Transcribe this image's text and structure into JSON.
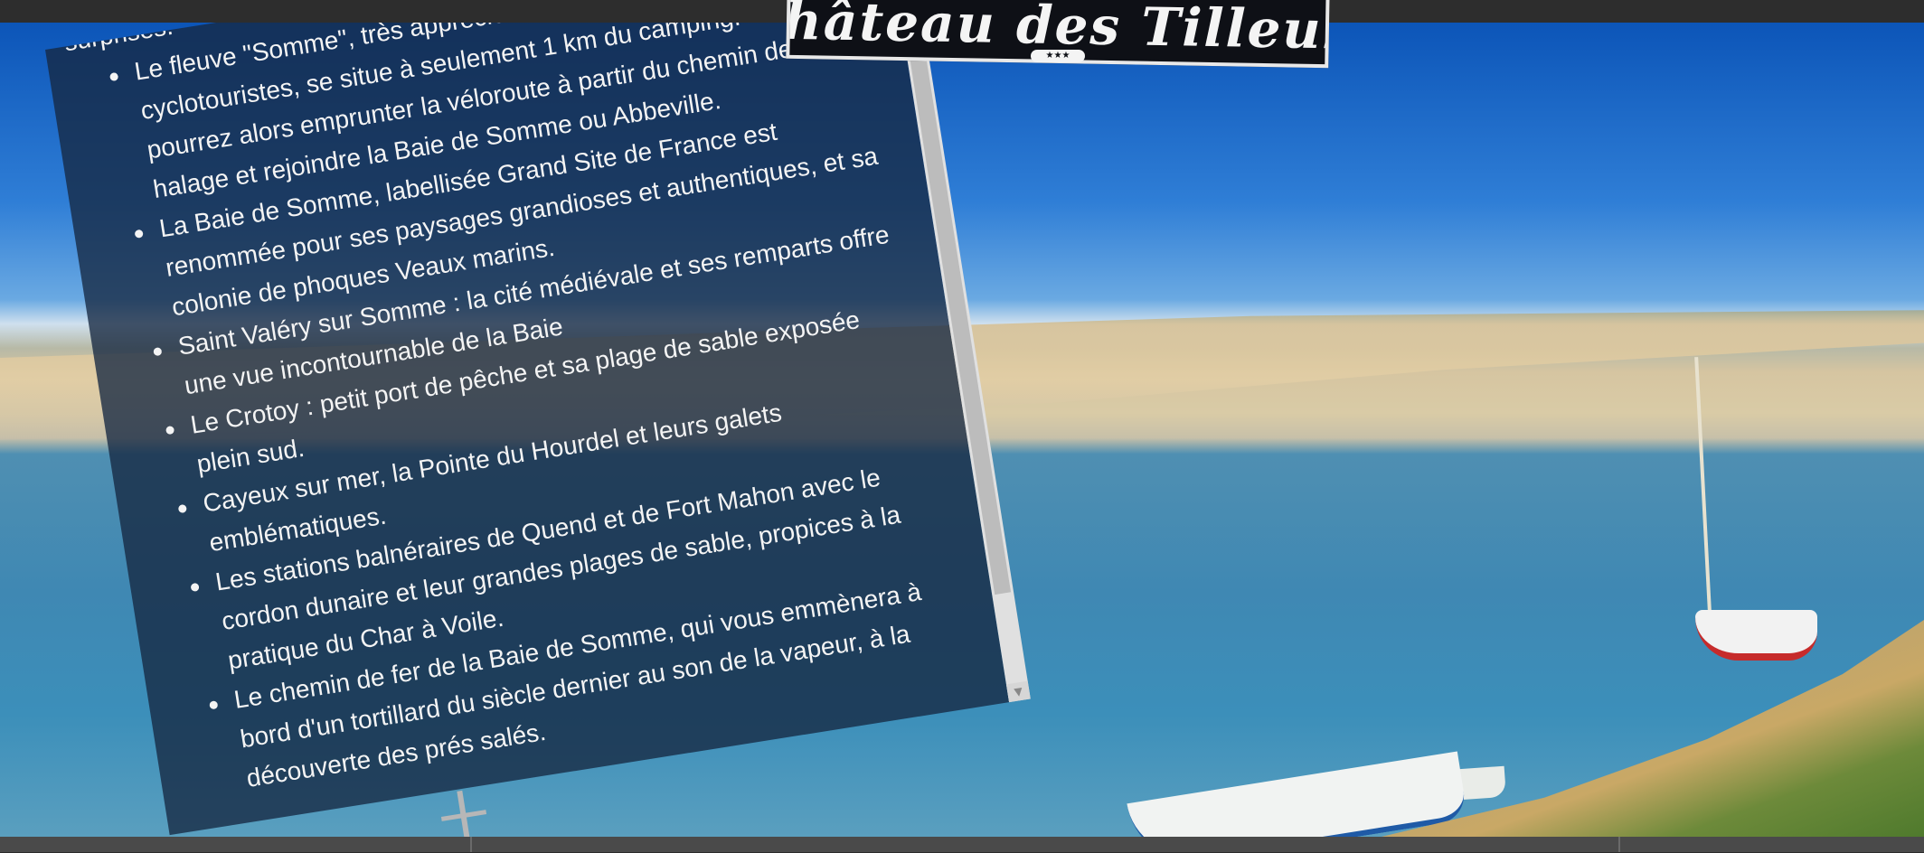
{
  "header": {
    "logo_text": "Château des Tilleuls",
    "logo_stars": "★★★"
  },
  "panel": {
    "lead_text": "surprises.",
    "items": [
      "Le fleuve \"Somme\", très apprécié des joggeurs et des cyclotouristes, se situe à seulement 1 km du camping. Vous pourrez alors emprunter la véloroute à partir du chemin de halage et rejoindre la Baie de Somme ou Abbeville.",
      "La Baie de Somme, labellisée Grand Site de France est renommée pour ses paysages grandioses et authentiques, et sa colonie de phoques Veaux marins.",
      "Saint Valéry sur Somme : la cité médiévale et ses remparts offre une vue incontournable de la Baie",
      "Le Crotoy : petit port de pêche et sa plage de sable exposée plein sud.",
      "Cayeux sur mer, la Pointe du Hourdel et leurs galets emblématiques.",
      "Les stations balnéraires de Quend et de Fort Mahon avec le cordon dunaire et leur grandes plages de sable, propices à la pratique du Char à Voile.",
      "Le chemin de fer de la Baie de Somme, qui vous emmènera à bord d'un tortillard du siècle dernier au son de la vapeur, à la découverte des prés salés."
    ],
    "scroll_down_icon": "▼"
  }
}
